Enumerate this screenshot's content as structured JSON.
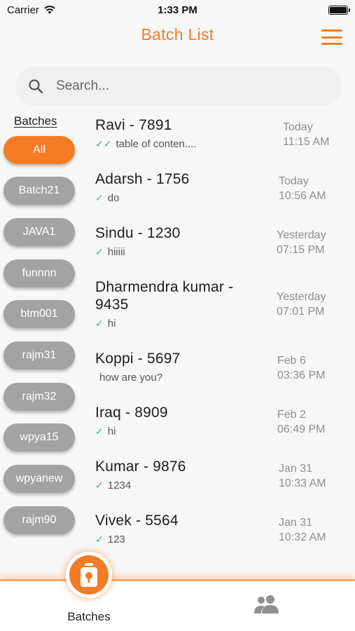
{
  "status_bar": {
    "carrier": "Carrier",
    "time": "1:33 PM"
  },
  "header": {
    "title": "Batch List"
  },
  "search": {
    "placeholder": "Search..."
  },
  "batches": {
    "heading": "Batches",
    "items": [
      "All",
      "Batch21",
      "JAVA1",
      "funnnn",
      "btm001",
      "rajm31",
      "rajm32",
      "wpya15",
      "wpyanew",
      "rajm90"
    ]
  },
  "chats": [
    {
      "name": "Ravi - 7891",
      "message": "table of conten....",
      "status": "double-check-icon",
      "date": "Today",
      "time": "11:15 AM"
    },
    {
      "name": "Adarsh - 1756",
      "message": "do",
      "status": "check-icon",
      "date": "Today",
      "time": "10:56 AM"
    },
    {
      "name": "Sindu - 1230",
      "message": "hiiiii",
      "status": "check-icon",
      "date": "Yesterday",
      "time": "07:15 PM"
    },
    {
      "name": "Dharmendra kumar - 9435",
      "message": "hi",
      "status": "check-icon",
      "date": "Yesterday",
      "time": "07:01 PM"
    },
    {
      "name": "Koppi - 5697",
      "message": "how are you?",
      "status": "none",
      "date": "Feb 6",
      "time": "03:36 PM"
    },
    {
      "name": "Iraq - 8909",
      "message": "hi",
      "status": "check-icon",
      "date": "Feb 2",
      "time": "06:49 PM"
    },
    {
      "name": "Kumar - 9876",
      "message": "1234",
      "status": "check-icon",
      "date": "Jan 31",
      "time": "10:33 AM"
    },
    {
      "name": "Vivek - 5564",
      "message": "123",
      "status": "check-icon",
      "date": "Jan 31",
      "time": "10:32 AM"
    }
  ],
  "tabbar": {
    "batches_label": "Batches",
    "icons": [
      "batches-icon",
      "people-icon"
    ]
  },
  "colors": {
    "accent": "#f47c27",
    "pill_inactive": "#a3a3a3",
    "check": "#3cb878"
  }
}
